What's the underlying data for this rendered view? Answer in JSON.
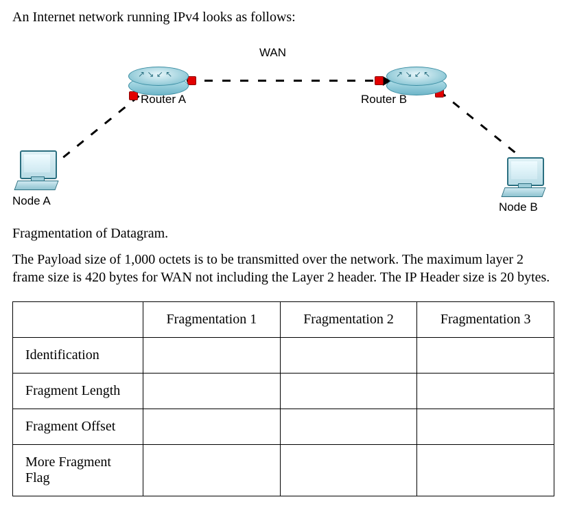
{
  "title": "An Internet network running IPv4 looks as follows:",
  "diagram": {
    "wan_label": "WAN",
    "router_a_label": "Router A",
    "router_b_label": "Router B",
    "node_a_label": "Node A",
    "node_b_label": "Node B"
  },
  "section_heading": "Fragmentation of Datagram.",
  "body_text": "The Payload size of 1,000 octets is to be transmitted over the network.  The maximum layer 2 frame size is 420 bytes for WAN not including the Layer 2 header.  The IP Header size is 20 bytes.",
  "table": {
    "columns": [
      "Fragmentation 1",
      "Fragmentation 2",
      "Fragmentation 3"
    ],
    "rows": [
      {
        "label": "Identification",
        "cells": [
          "",
          "",
          ""
        ]
      },
      {
        "label": "Fragment Length",
        "cells": [
          "",
          "",
          ""
        ]
      },
      {
        "label": "Fragment Offset",
        "cells": [
          "",
          "",
          ""
        ]
      },
      {
        "label": "More Fragment Flag",
        "cells": [
          "",
          "",
          ""
        ]
      }
    ]
  }
}
